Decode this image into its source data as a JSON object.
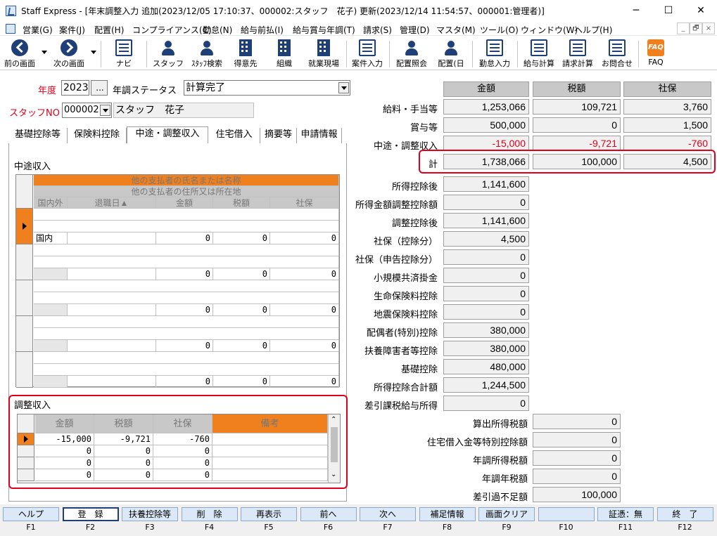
{
  "titlebar": {
    "title": "Staff Express - [年末調整入力  追加(2023/12/05 17:10:37、000002:スタッフ　花子)  更新(2023/12/14 11:54:57、000001:管理者)]",
    "minimize": "─",
    "maximize": "☐",
    "close": "✕"
  },
  "menu": [
    "営業(G)",
    "案件(J)",
    "配置(H)",
    "コンプライアンス(C)",
    "勤怠(N)",
    "給与前払(I)",
    "給与賞与年調(T)",
    "請求(S)",
    "管理(D)",
    "マスタ(M)",
    "ツール(O)",
    "ウィンドウ(W)",
    "ヘルプ(H)"
  ],
  "mdi": {
    "min": "_",
    "restore": "🗗",
    "close": "×"
  },
  "toolbar": [
    "前の画面",
    "次の画面",
    "ナビ",
    "スタッフ",
    "ｽﾀｯﾌ検索",
    "得意先",
    "組織",
    "就業現場",
    "案件入力",
    "配置照会",
    "配置(日",
    "勤怠入力",
    "給与計算",
    "請求計算",
    "お問合せ",
    "FAQ"
  ],
  "form": {
    "year_label": "年度",
    "year": "2023",
    "year_btn": "...",
    "status_label": "年調ステータス",
    "status": "計算完了",
    "staff_label": "スタッフNO",
    "staff_no": "000002",
    "staff_name": "スタッフ　花子"
  },
  "tabs": [
    "基礎控除等",
    "保険料控除",
    "中途・調整収入",
    "住宅借入",
    "摘要等",
    "申請情報"
  ],
  "chuto": {
    "title": "中途収入",
    "head1": "他の支払者の氏名または名称",
    "head2": "他の支払者の住所又は所在地",
    "cols": [
      "国内外",
      "退職日▲",
      "金額",
      "税額",
      "社保"
    ],
    "rows": [
      {
        "kokunai": "国内",
        "date": "",
        "amount": "0",
        "tax": "0",
        "shaho": "0"
      },
      {
        "kokunai": "",
        "date": "",
        "amount": "0",
        "tax": "0",
        "shaho": "0"
      },
      {
        "kokunai": "",
        "date": "",
        "amount": "0",
        "tax": "0",
        "shaho": "0"
      },
      {
        "kokunai": "",
        "date": "",
        "amount": "0",
        "tax": "0",
        "shaho": "0"
      },
      {
        "kokunai": "",
        "date": "",
        "amount": "0",
        "tax": "0",
        "shaho": "0"
      }
    ]
  },
  "chosei": {
    "title": "調整収入",
    "cols": [
      "金額",
      "税額",
      "社保",
      "備考"
    ],
    "rows": [
      {
        "amount": "-15,000",
        "tax": "-9,721",
        "shaho": "-760",
        "note": ""
      },
      {
        "amount": "0",
        "tax": "0",
        "shaho": "0",
        "note": ""
      },
      {
        "amount": "0",
        "tax": "0",
        "shaho": "0",
        "note": ""
      },
      {
        "amount": "0",
        "tax": "0",
        "shaho": "0",
        "note": ""
      }
    ]
  },
  "summary": {
    "cols": [
      "金額",
      "税額",
      "社保"
    ],
    "rows": [
      {
        "label": "給料・手当等",
        "amount": "1,253,066",
        "tax": "109,721",
        "shaho": "3,760"
      },
      {
        "label": "賞与等",
        "amount": "500,000",
        "tax": "0",
        "shaho": "1,500"
      },
      {
        "label": "中途・調整収入",
        "amount": "-15,000",
        "tax": "-9,721",
        "shaho": "-760"
      },
      {
        "label": "計",
        "amount": "1,738,066",
        "tax": "100,000",
        "shaho": "4,500"
      }
    ],
    "deductions": [
      {
        "label": "所得控除後",
        "value": "1,141,600"
      },
      {
        "label": "所得金額調整控除額",
        "value": "0"
      },
      {
        "label": "調整控除後",
        "value": "1,141,600"
      },
      {
        "label": "社保（控除分）",
        "value": "4,500"
      },
      {
        "label": "社保（申告控除分）",
        "value": "0"
      },
      {
        "label": "小規模共済掛金",
        "value": "0"
      },
      {
        "label": "生命保険料控除",
        "value": "0"
      },
      {
        "label": "地震保険料控除",
        "value": "0"
      },
      {
        "label": "配偶者(特別)控除",
        "value": "380,000"
      },
      {
        "label": "扶養障害者等控除",
        "value": "380,000"
      },
      {
        "label": "基礎控除",
        "value": "480,000"
      },
      {
        "label": "所得控除合計額",
        "value": "1,244,500"
      },
      {
        "label": "差引課税給与所得",
        "value": "0"
      }
    ],
    "taxes": [
      {
        "label": "算出所得税額",
        "value": "0"
      },
      {
        "label": "住宅借入金等特別控除額",
        "value": "0"
      },
      {
        "label": "年調所得税額",
        "value": "0"
      },
      {
        "label": "年調年税額",
        "value": "0"
      },
      {
        "label": "差引過不足額",
        "value": "100,000"
      }
    ]
  },
  "fkeys": [
    {
      "label": "ヘルプ",
      "key": "F1"
    },
    {
      "label": "登　録",
      "key": "F2"
    },
    {
      "label": "扶養控除等",
      "key": "F3"
    },
    {
      "label": "削　除",
      "key": "F4"
    },
    {
      "label": "再表示",
      "key": "F5"
    },
    {
      "label": "前へ",
      "key": "F6"
    },
    {
      "label": "次へ",
      "key": "F7"
    },
    {
      "label": "補足情報",
      "key": "F8"
    },
    {
      "label": "画面クリア",
      "key": "F9"
    },
    {
      "label": "",
      "key": "F10"
    },
    {
      "label": "証憑：無",
      "key": "F11"
    },
    {
      "label": "終　了",
      "key": "F12"
    }
  ]
}
